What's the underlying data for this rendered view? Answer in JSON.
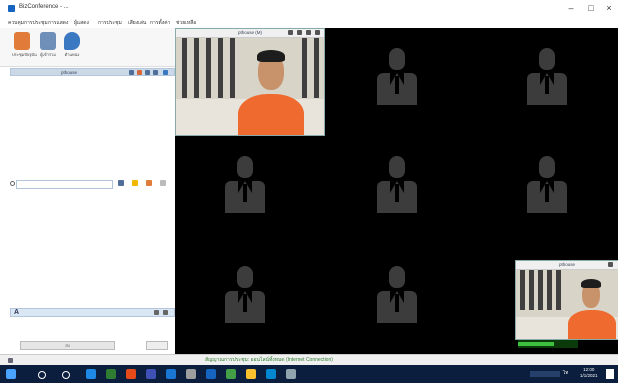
{
  "window": {
    "title": "BizConference - ...",
    "minimize": "–",
    "maximize": "□",
    "close": "×"
  },
  "menu": [
    "ควบคุมการประชุม",
    "การแสดง",
    "ผู้แสดง",
    "การประชุม",
    "เสียงเล่น",
    "การตั้งค่า",
    "ช่วยเหลือ"
  ],
  "toolbar": [
    {
      "label": "ประชุมปัจจุบัน",
      "icon": "hand-icon",
      "color": "#e07b39"
    },
    {
      "label": "ผู้เข้าร่วม",
      "icon": "user-share-icon",
      "color": "#6f8fb8"
    },
    {
      "label": "ตำแหน่ง",
      "icon": "location-pin-icon",
      "color": "#3a78c2"
    }
  ],
  "panel": {
    "header_label": "pthouse"
  },
  "chat": {
    "font_indicator": "A"
  },
  "send_button": "ส่ง",
  "videos": {
    "main_label": "pthouse (M)",
    "self_label": "pthouse"
  },
  "status": {
    "text": "สัญญาณการประชุม: ออนไลน์ทั้งหมด (Internet Connection)"
  },
  "taskbar": {
    "time": "12:00",
    "date": "1/1/2021",
    "lang": "ไท"
  },
  "colors": {
    "accent": "#1565c0",
    "video_bg": "#000000",
    "placeholder": "#3c3c3c",
    "status_ok": "#2e7d32",
    "taskbar": "#0b1e3d"
  }
}
